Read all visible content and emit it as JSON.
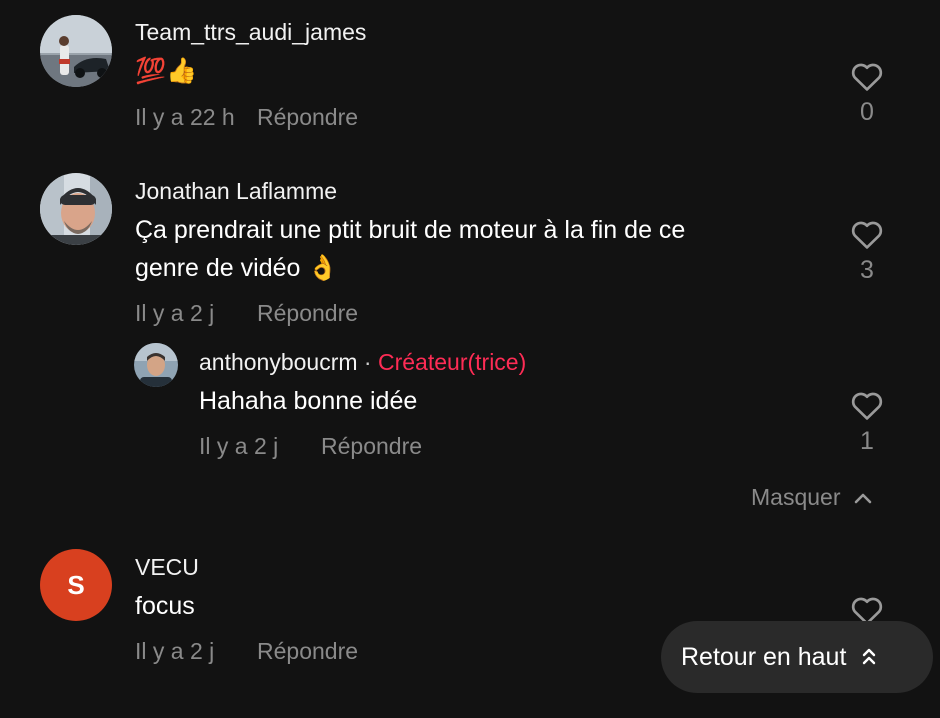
{
  "comments": [
    {
      "username": "Team_ttrs_audi_james",
      "text": "💯👍",
      "time": "Il y a 22 h",
      "reply_label": "Répondre",
      "likes": "0"
    },
    {
      "username": "Jonathan Laflamme",
      "text_line1": "Ça prendrait une ptit bruit de moteur à la fin de ce",
      "text_line2": "genre de vidéo 👌",
      "time": "Il y a 2 j",
      "reply_label": "Répondre",
      "likes": "3",
      "replies": [
        {
          "username": "anthonyboucrm",
          "separator": " · ",
          "badge": "Créateur(trice)",
          "text": "Hahaha bonne idée",
          "time": "Il y a 2 j",
          "reply_label": "Répondre",
          "likes": "1"
        }
      ],
      "hide_label": "Masquer"
    },
    {
      "username": "VECU",
      "avatar_letter": "S",
      "avatar_color": "#d8401f",
      "text": "focus",
      "time": "Il y a 2 j",
      "reply_label": "Répondre"
    }
  ],
  "back_to_top_label": "Retour en haut",
  "icons": {
    "like": "heart-outline-icon",
    "hide": "chevron-up-icon",
    "back_to_top": "double-chevron-up-icon"
  },
  "colors": {
    "background": "#121212",
    "creator_badge": "#fe2c55",
    "secondary_text": "#8a8a8a",
    "pill_background": "#2a2a2a"
  }
}
